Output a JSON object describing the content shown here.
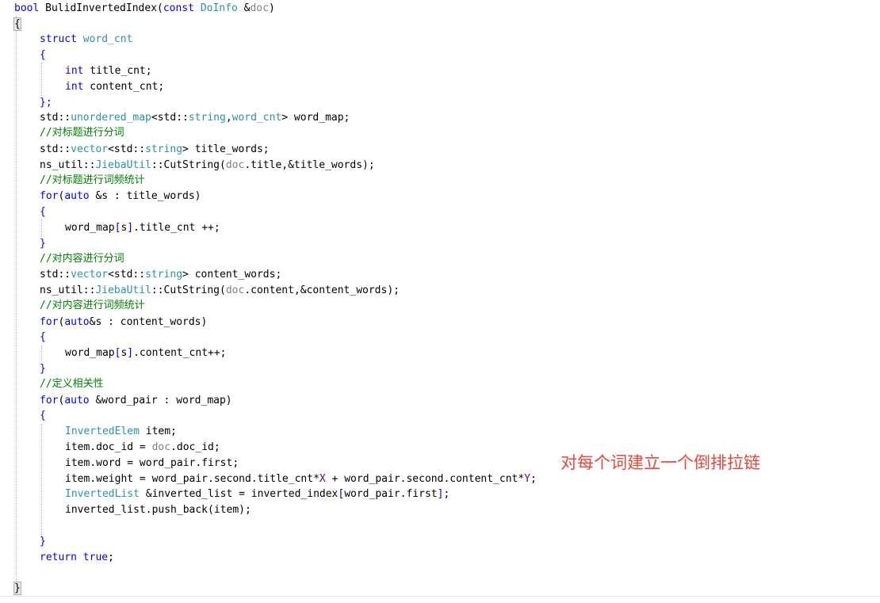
{
  "code": {
    "l1": {
      "kw": "bool",
      "fn": " BulidInvertedIndex(",
      "kw2": "const",
      "sp": " ",
      "ty": "DoInfo",
      "rest": " &",
      "pm": "doc",
      "end": ")"
    },
    "l2": {
      "t": "{"
    },
    "l3": {
      "kw": "struct",
      "sp": " ",
      "ty": "word_cnt"
    },
    "l4": {
      "t": "{"
    },
    "l5": {
      "kw": "int",
      "t": " title_cnt;"
    },
    "l6": {
      "kw": "int",
      "t": " content_cnt;"
    },
    "l7": {
      "t": "};"
    },
    "l8": {
      "a": "std::",
      "ty": "unordered_map",
      "b": "<std::",
      "ty2": "string",
      "c": ",",
      "ty3": "word_cnt",
      "d": "> word_map;"
    },
    "l9": {
      "cm": "//对标题进行分词"
    },
    "l10": {
      "a": "std::",
      "ty": "vector",
      "b": "<std::",
      "ty2": "string",
      "c": "> title_words;"
    },
    "l11": {
      "a": "ns_util::",
      "ty": "JiebaUtil",
      "b": "::CutString(",
      "pm": "doc",
      "c": ".title,&title_words);"
    },
    "l12": {
      "cm": "//对标题进行词频统计"
    },
    "l13": {
      "kw": "for",
      "a": "(",
      "kw2": "auto",
      "b": " &s : title_words)"
    },
    "l14": {
      "t": "{"
    },
    "l15": {
      "a": "word_map",
      "p1": "[",
      "b": "s",
      "p2": "]",
      "c": ".title_cnt ++;"
    },
    "l16": {
      "t": "}"
    },
    "l17": {
      "cm": "//对内容进行分词"
    },
    "l18": {
      "a": "std::",
      "ty": "vector",
      "b": "<std::",
      "ty2": "string",
      "c": "> content_words;"
    },
    "l19": {
      "a": "ns_util::",
      "ty": "JiebaUtil",
      "b": "::CutString(",
      "pm": "doc",
      "c": ".content,&content_words);"
    },
    "l20": {
      "cm": "//对内容进行词频统计"
    },
    "l21": {
      "kw": "for",
      "a": "(",
      "kw2": "auto",
      "b": "&s : content_words)"
    },
    "l22": {
      "t": "{"
    },
    "l23": {
      "a": "word_map",
      "p1": "[",
      "b": "s",
      "p2": "]",
      "c": ".content_cnt++;"
    },
    "l24": {
      "t": "}"
    },
    "l25": {
      "cm": "//定义相关性"
    },
    "l26": {
      "kw": "for",
      "a": "(",
      "kw2": "auto",
      "b": " &word_pair : word_map)"
    },
    "l27": {
      "t": "{"
    },
    "l28": {
      "ty": "InvertedElem",
      "t": " item;"
    },
    "l29": {
      "a": "item.doc_id = ",
      "pm": "doc",
      "b": ".doc_id;"
    },
    "l30": {
      "t": "item.word = word_pair.first;"
    },
    "l31": {
      "a": "item.weight = word_pair.second.title_cnt*",
      "m1": "X",
      "b": " + word_pair.second.content_cnt*",
      "m2": "Y",
      "c": ";"
    },
    "l32": {
      "ty": "InvertedList",
      "a": " &inverted_list = inverted_index",
      "p1": "[",
      "b": "word_pair.first",
      "p2": "]",
      "c": ";"
    },
    "l33": {
      "t": "inverted_list.push_back(item);"
    },
    "l35": {
      "t": "}"
    },
    "l36": {
      "kw": "return",
      "sp": " ",
      "kw2": "true",
      "t": ";"
    },
    "l38": {
      "t": "}"
    }
  },
  "annotation": {
    "text": "对每个词建立一个倒排拉链"
  },
  "colors": {
    "keyword": "#0000ff",
    "type": "#2b91af",
    "comment": "#008000",
    "parameter": "#808080",
    "macro": "#6f008a",
    "annotation": "#e8473c"
  }
}
